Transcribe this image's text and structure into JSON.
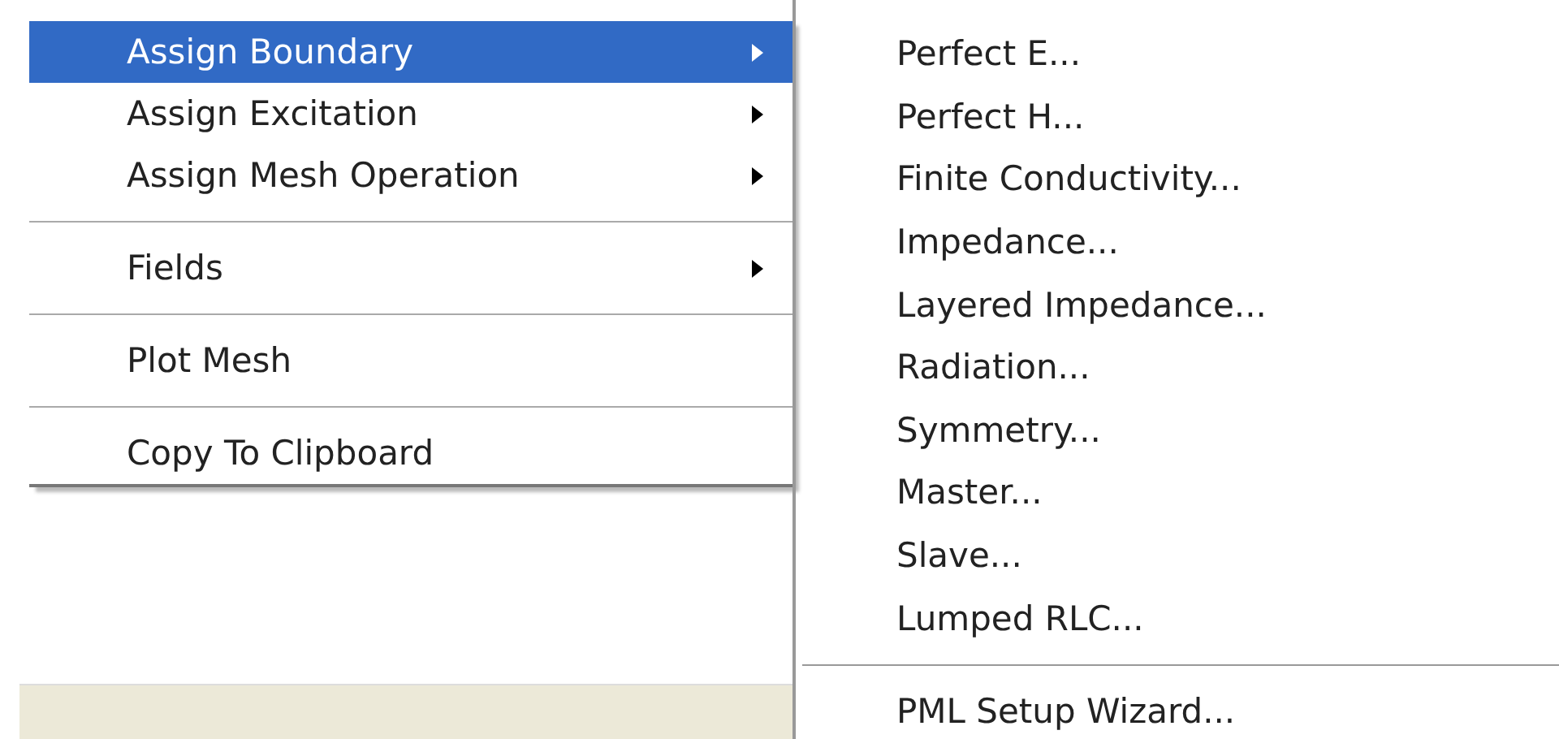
{
  "context_menu": {
    "items": [
      {
        "kind": "item",
        "label": "Assign Boundary",
        "has_submenu": true,
        "selected": true
      },
      {
        "kind": "item",
        "label": "Assign Excitation",
        "has_submenu": true,
        "selected": false
      },
      {
        "kind": "item",
        "label": "Assign Mesh Operation",
        "has_submenu": true,
        "selected": false
      },
      {
        "kind": "separator"
      },
      {
        "kind": "item",
        "label": "Fields",
        "has_submenu": true,
        "selected": false
      },
      {
        "kind": "separator"
      },
      {
        "kind": "item",
        "label": "Plot Mesh",
        "has_submenu": false,
        "selected": false
      },
      {
        "kind": "separator"
      },
      {
        "kind": "item",
        "label": "Copy To Clipboard",
        "has_submenu": false,
        "selected": false
      }
    ]
  },
  "submenu": {
    "items": [
      {
        "kind": "item",
        "label": "Perfect E..."
      },
      {
        "kind": "item",
        "label": "Perfect H..."
      },
      {
        "kind": "item",
        "label": "Finite Conductivity..."
      },
      {
        "kind": "item",
        "label": "Impedance..."
      },
      {
        "kind": "item",
        "label": "Layered Impedance..."
      },
      {
        "kind": "item",
        "label": "Radiation..."
      },
      {
        "kind": "item",
        "label": "Symmetry..."
      },
      {
        "kind": "item",
        "label": "Master..."
      },
      {
        "kind": "item",
        "label": "Slave..."
      },
      {
        "kind": "item",
        "label": "Lumped RLC..."
      },
      {
        "kind": "separator"
      },
      {
        "kind": "item",
        "label": "PML Setup Wizard..."
      }
    ]
  }
}
